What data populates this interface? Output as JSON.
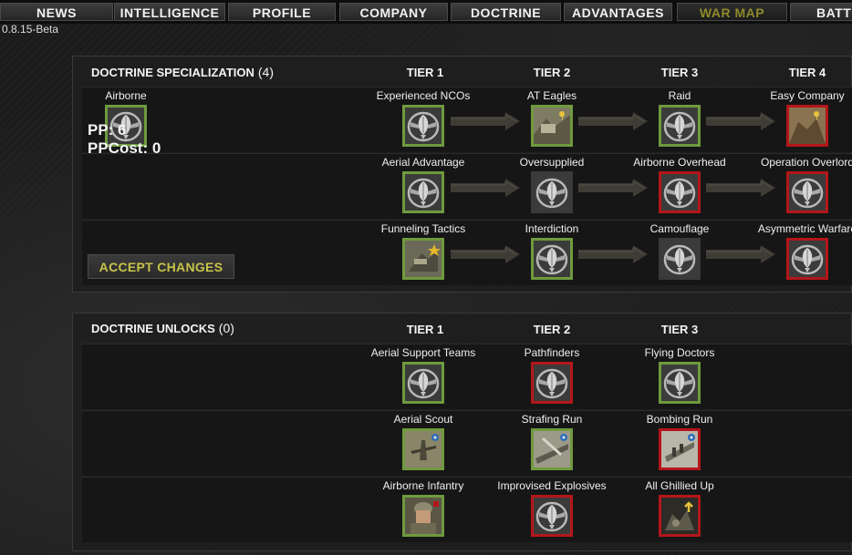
{
  "nav": {
    "tabs": [
      {
        "label": "NEWS"
      },
      {
        "label": "INTELLIGENCE"
      },
      {
        "label": "PROFILE"
      },
      {
        "label": "COMPANY"
      },
      {
        "label": "DOCTRINE"
      },
      {
        "label": "ADVANTAGES"
      },
      {
        "label": "WAR MAP"
      },
      {
        "label": "BATT"
      }
    ]
  },
  "version": "0.8.15-Beta",
  "specialization": {
    "title": "DOCTRINE SPECIALIZATION",
    "count": "(4)",
    "tiers": [
      "TIER 1",
      "TIER 2",
      "TIER 3",
      "TIER 4"
    ],
    "doctrine_name": "Airborne",
    "pp": "PP: 6",
    "ppcost": "PPCost: 0",
    "accept_label": "ACCEPT CHANGES",
    "rows": [
      [
        "Experienced NCOs",
        "AT Eagles",
        "Raid",
        "Easy Company"
      ],
      [
        "Aerial Advantage",
        "Oversupplied",
        "Airborne Overhead",
        "Operation Overlord"
      ],
      [
        "Funneling Tactics",
        "Interdiction",
        "Camouflage",
        "Asymmetric Warfare"
      ]
    ]
  },
  "unlocks": {
    "title": "DOCTRINE UNLOCKS",
    "count": "(0)",
    "tiers": [
      "TIER 1",
      "TIER 2",
      "TIER 3"
    ],
    "rows": [
      [
        "Aerial Support Teams",
        "Pathfinders",
        "Flying Doctors"
      ],
      [
        "Aerial Scout",
        "Strafing Run",
        "Bombing Run"
      ],
      [
        "Airborne Infantry",
        "Improvised Explosives",
        "All Ghillied Up"
      ]
    ]
  },
  "icons": {
    "badge": "airborne-wings-badge-icon",
    "arrow": "progression-arrow-icon"
  },
  "colors": {
    "owned_border": "#6f9a3e",
    "locked_border": "#b4161a",
    "unavailable_border": "#3a3a3a",
    "accept_text": "#c7c44a",
    "active_tab_text": "#8f8a2a"
  }
}
